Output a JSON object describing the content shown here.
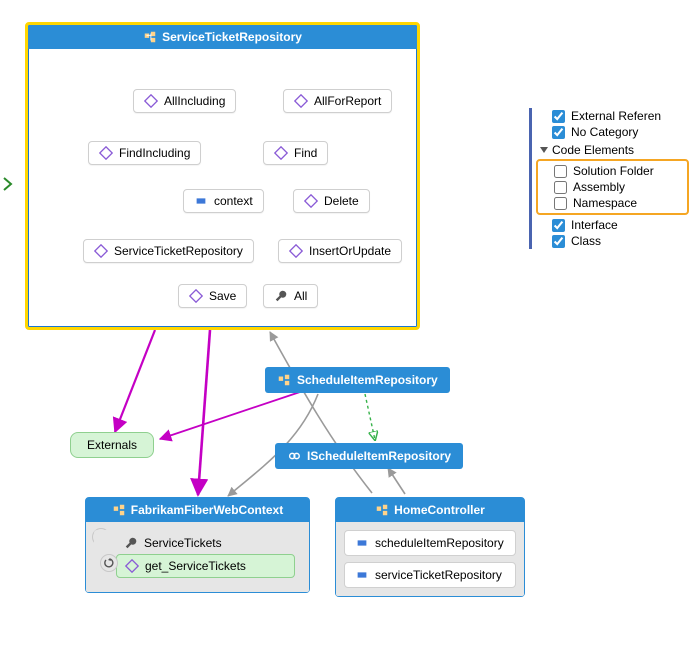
{
  "colors": {
    "header": "#2b8dd6",
    "highlight_border": "#ffd600",
    "externals_bg": "#d6f4d6",
    "arrow_blue": "#2b8dd6",
    "arrow_gray": "#9a9a9a",
    "arrow_magenta": "#c400c4",
    "arrow_green": "#36b24a"
  },
  "main": {
    "title": "ServiceTicketRepository",
    "nodes": {
      "allIncluding": "AllIncluding",
      "allForReport": "AllForReport",
      "findIncluding": "FindIncluding",
      "find": "Find",
      "context": "context",
      "delete": "Delete",
      "repoCtor": "ServiceTicketRepository",
      "insertOrUpdate": "InsertOrUpdate",
      "save": "Save",
      "all": "All"
    }
  },
  "schedule": {
    "title": "ScheduleItemRepository",
    "iface": "IScheduleItemRepository"
  },
  "externals": "Externals",
  "fabrikam": {
    "title": "FabrikamFiberWebContext",
    "serviceTickets": "ServiceTickets",
    "get": "get_ServiceTickets"
  },
  "home": {
    "title": "HomeController",
    "m1": "scheduleItemRepository",
    "m2": "serviceTicketRepository"
  },
  "legend": {
    "externalRef": "External Referen",
    "noCategory": "No Category",
    "heading": "Code Elements",
    "solutionFolder": "Solution Folder",
    "assembly": "Assembly",
    "namespace": "Namespace",
    "interface": "Interface",
    "class": "Class"
  }
}
